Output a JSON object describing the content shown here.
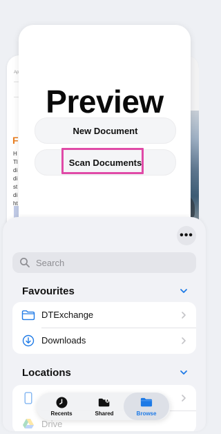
{
  "background": {
    "left_doc": {
      "header_text": "Ap",
      "heading_initial": "F",
      "lines": [
        "H",
        "Tl",
        "di",
        "di",
        "st",
        "di",
        "ht"
      ]
    }
  },
  "preview": {
    "title": "Preview",
    "new_document_label": "New Document",
    "scan_documents_label": "Scan Documents",
    "highlight_color": "#e04aa7"
  },
  "browser": {
    "more_label": "•••",
    "search": {
      "placeholder": "Search"
    },
    "favourites": {
      "title": "Favourites",
      "items": [
        {
          "label": "DTExchange",
          "icon": "folder-icon"
        },
        {
          "label": "Downloads",
          "icon": "download-circle-icon"
        }
      ]
    },
    "locations": {
      "title": "Locations",
      "items": [
        {
          "label": "",
          "icon": "iphone-icon"
        },
        {
          "label": "Drive",
          "icon": "google-drive-icon"
        }
      ]
    }
  },
  "tabbar": {
    "tabs": [
      {
        "label": "Recents",
        "icon": "clock-icon",
        "selected": false
      },
      {
        "label": "Shared",
        "icon": "shared-folder-icon",
        "selected": false
      },
      {
        "label": "Browse",
        "icon": "folder-icon",
        "selected": true
      }
    ],
    "accent_color": "#1e7ae6"
  }
}
